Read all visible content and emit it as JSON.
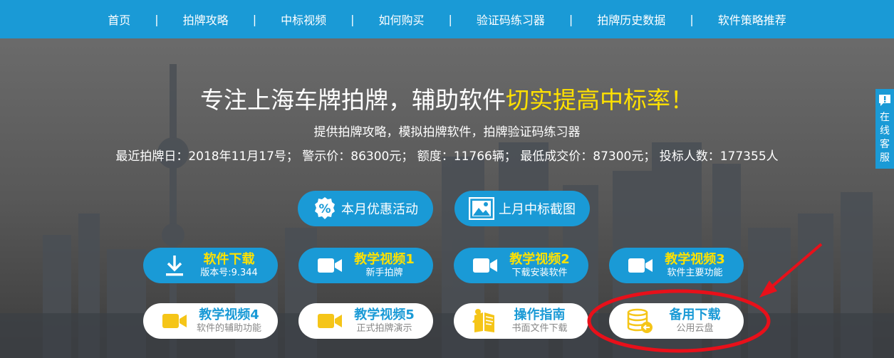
{
  "nav": {
    "items": [
      {
        "label": "首页"
      },
      {
        "label": "拍牌攻略"
      },
      {
        "label": "中标视频"
      },
      {
        "label": "如何购买"
      },
      {
        "label": "验证码练习器"
      },
      {
        "label": "拍牌历史数据"
      },
      {
        "label": "软件策略推荐"
      }
    ],
    "separator": "|"
  },
  "hero": {
    "title_main": "专注上海车牌拍牌，辅助软件",
    "title_highlight": "切实提高中标率！",
    "subtitle": "提供拍牌攻略，模拟拍牌软件，拍牌验证码练习器",
    "stats": "最近拍牌日：2018年11月17号； 警示价：86300元； 额度：11766辆； 最低成交价：87300元； 投标人数：177355人"
  },
  "pills": {
    "promo": "本月优惠活动",
    "screenshot": "上月中标截图"
  },
  "buttons": [
    {
      "title": "软件下载",
      "sub": "版本号:9.344",
      "icon": "download-icon"
    },
    {
      "title": "教学视频1",
      "sub": "新手拍牌",
      "icon": "video-camera-icon"
    },
    {
      "title": "教学视频2",
      "sub": "下载安装软件",
      "icon": "video-camera-icon"
    },
    {
      "title": "教学视频3",
      "sub": "软件主要功能",
      "icon": "video-camera-icon"
    },
    {
      "title": "教学视频4",
      "sub": "软件的辅助功能",
      "icon": "video-camera-icon"
    },
    {
      "title": "教学视频5",
      "sub": "正式拍牌演示",
      "icon": "video-camera-icon"
    },
    {
      "title": "操作指南",
      "sub": "书面文件下载",
      "icon": "guide-book-icon"
    },
    {
      "title": "备用下载",
      "sub": "公用云盘",
      "icon": "cloud-storage-icon"
    }
  ],
  "side_widget": {
    "chars": [
      "在",
      "线",
      "客",
      "服"
    ]
  },
  "colors": {
    "brand_blue": "#1a9ad6",
    "highlight_yellow": "#ffe100",
    "icon_yellow": "#f5c518",
    "annotation_red": "#e8101a"
  }
}
